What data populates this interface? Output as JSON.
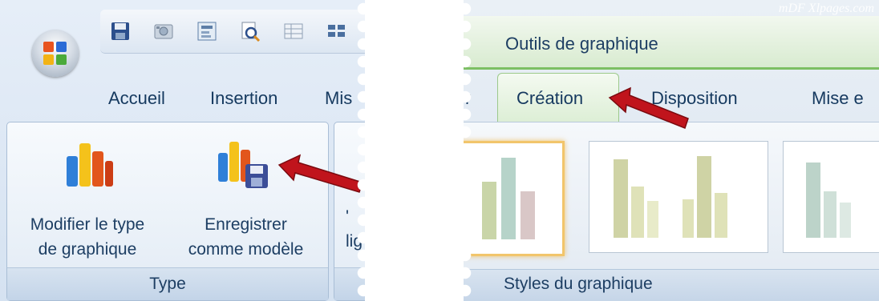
{
  "left": {
    "tabs": [
      "Accueil",
      "Insertion",
      "Mis"
    ],
    "commands": [
      {
        "line1": "Modifier le type",
        "line2": "de graphique"
      },
      {
        "line1": "Enregistrer",
        "line2": "comme modèle"
      }
    ],
    "cut_label": "lig",
    "cut_label_top": "'",
    "group_label": "Type"
  },
  "right": {
    "context_title": "Outils de graphique",
    "watermark": "mDF Xlpages.com",
    "prev_tab_fragment": "r",
    "tabs": [
      "Création",
      "Disposition",
      "Mise e"
    ],
    "group_label": "Styles du graphique"
  },
  "colors": {
    "ribbon_blue": "#dfe8f3",
    "context_green": "#7cbf63",
    "arrow_red": "#c0141c",
    "selected_style": "#f2c56b"
  },
  "icons": [
    "office-button-icon",
    "save-icon",
    "camera-icon",
    "form-icon",
    "print-preview-icon",
    "table-icon",
    "grid-icon",
    "bar-chart-icon",
    "save-as-template-icon",
    "red-arrow-icon"
  ]
}
